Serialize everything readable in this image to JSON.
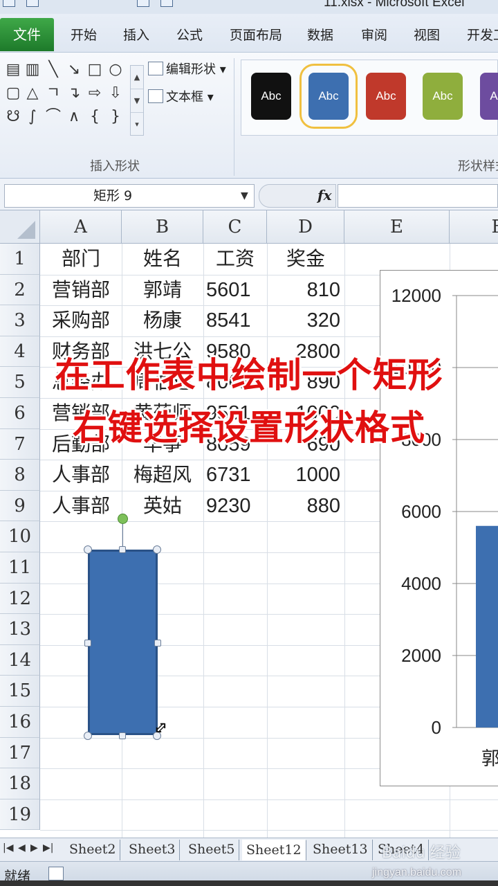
{
  "window": {
    "title": "11.xlsx - Microsoft Excel"
  },
  "ribbon": {
    "file_tab": "文件",
    "tabs": [
      "开始",
      "插入",
      "公式",
      "页面布局",
      "数据",
      "审阅",
      "视图",
      "开发工"
    ],
    "edit_shape": "编辑形状",
    "text_box": "文本框",
    "insert_shapes_label": "插入形状",
    "shape_styles_label": "形状样式",
    "style_swatch_label": "Abc",
    "style_colors": [
      "#111111",
      "#3d6fb0",
      "#c0392b",
      "#8fae3d",
      "#6d4c9f"
    ]
  },
  "formula_bar": {
    "name_box": "矩形 9",
    "fx_label": "fx",
    "formula": ""
  },
  "grid": {
    "columns": [
      "A",
      "B",
      "C",
      "D",
      "E",
      "F"
    ],
    "rows": [
      "1",
      "2",
      "3",
      "4",
      "5",
      "6",
      "7",
      "8",
      "9",
      "10",
      "11",
      "12",
      "13",
      "14",
      "15",
      "16",
      "17",
      "18",
      "19"
    ],
    "cells": [
      [
        "部门",
        "姓名",
        "工资",
        "奖金"
      ],
      [
        "营销部",
        "郭靖",
        "5601",
        "810"
      ],
      [
        "采购部",
        "杨康",
        "8541",
        "320"
      ],
      [
        "财务部",
        "洪七公",
        "9580",
        "2800"
      ],
      [
        "总经办",
        "周伯通",
        "8061",
        "890"
      ],
      [
        "营销部",
        "黄药师",
        "9581",
        "1000"
      ],
      [
        "后勤部",
        "华筝",
        "8059",
        "690"
      ],
      [
        "人事部",
        "梅超风",
        "6731",
        "1000"
      ],
      [
        "人事部",
        "英姑",
        "9230",
        "880"
      ]
    ]
  },
  "chart_data": {
    "type": "bar",
    "categories": [
      "郭"
    ],
    "values": [
      5601
    ],
    "ylim": [
      0,
      12000
    ],
    "yticks": [
      "12000",
      "10000",
      "8000",
      "6000",
      "4000",
      "2000",
      "0"
    ],
    "grid": true,
    "bar_color": "#3d6fb0"
  },
  "overlay": {
    "line1": "在工作表中绘制一个矩形",
    "line2": "右键选择设置形状格式"
  },
  "sheets": {
    "tabs": [
      "Sheet2",
      "Sheet3",
      "Sheet5",
      "Sheet12",
      "Sheet13",
      "Sheet4"
    ],
    "active": "Sheet12"
  },
  "status": {
    "text": "就绪"
  },
  "watermark": {
    "brand": "Baidu 经验",
    "url": "jingyan.baidu.com"
  }
}
